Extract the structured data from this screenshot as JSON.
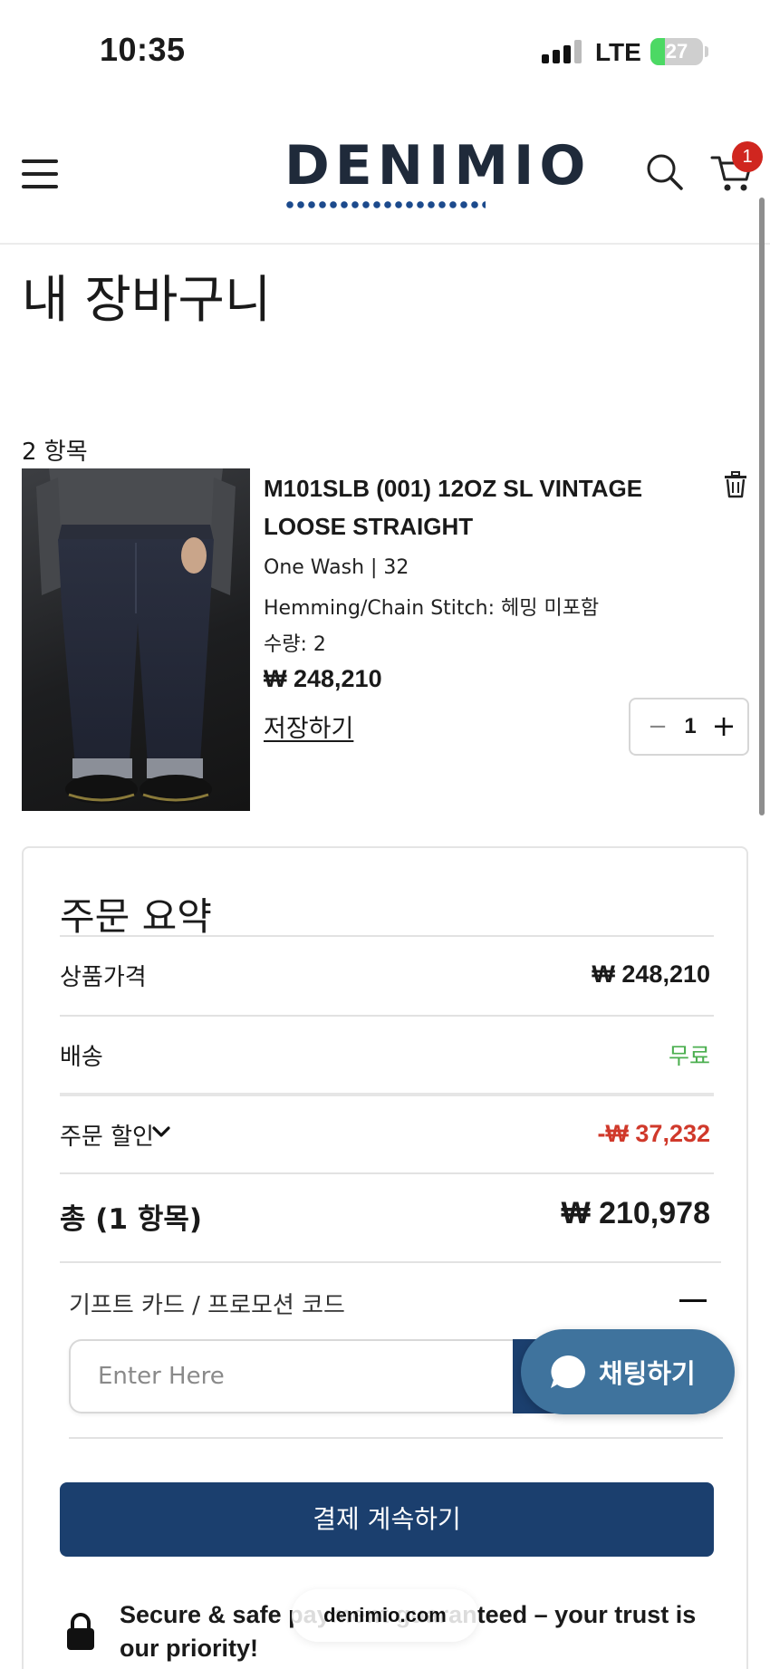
{
  "status_bar": {
    "time": "10:35",
    "network": "LTE",
    "battery_percent": 27,
    "battery_label": "27"
  },
  "header": {
    "logo_text": "DENIMIO",
    "cart_count": "1",
    "icons": {
      "menu": "hamburger-icon",
      "search": "search-icon",
      "cart": "cart-icon"
    }
  },
  "page": {
    "title": "내 장바구니",
    "item_count": "2 항목"
  },
  "cart_item": {
    "title": "M101SLB (001) 12OZ SL VINTAGE LOOSE STRAIGHT",
    "variant": "One Wash  | 32",
    "hemming": "Hemming/Chain Stitch: 헤밍 미포함",
    "quantity_line": "수량: 2",
    "price": "₩ 248,210",
    "save_label": "저장하기",
    "stepper_value": "1",
    "minus": "−",
    "plus": "+"
  },
  "summary": {
    "title": "주문 요약",
    "subtotal_label": "상품가격",
    "subtotal_value": "₩ 248,210",
    "shipping_label": "배송",
    "shipping_value": "무료",
    "discount_label": "주문 할인",
    "discount_value": "-₩ 37,232",
    "total_label": "총 (1 항목)",
    "total_value": "₩ 210,978",
    "promo_label": "기프트 카드 / 프로모션 코드",
    "promo_placeholder": "Enter Here",
    "checkout_label": "결제 계속하기",
    "secure_text": "Secure & safe payment guaranteed – your trust is our priority!"
  },
  "chat": {
    "label": "채팅하기"
  },
  "browser": {
    "url": "denimio.com"
  },
  "colors": {
    "brand_navy": "#1b3f6e",
    "chat_blue": "#3f739d",
    "badge_red": "#d0261f",
    "discount_red": "#d0392b",
    "free_green": "#4caf50"
  }
}
